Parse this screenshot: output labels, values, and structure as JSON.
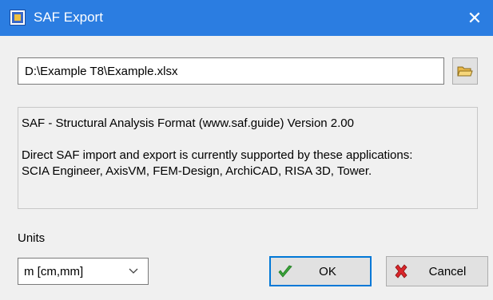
{
  "window": {
    "title": "SAF Export",
    "icon": "saf-app-icon",
    "close_glyph": "✕"
  },
  "file": {
    "path": "D:\\Example T8\\Example.xlsx",
    "browse_icon": "open-folder-icon"
  },
  "info": {
    "line1": "SAF - Structural Analysis Format  (www.saf.guide) Version 2.00",
    "line2": "Direct SAF import and export is currently supported by these applications:",
    "line3": "SCIA Engineer, AxisVM, FEM-Design, ArchiCAD, RISA 3D, Tower."
  },
  "units": {
    "label": "Units",
    "selected": "m [cm,mm]"
  },
  "buttons": {
    "ok_label": "OK",
    "ok_icon": "checkmark-icon",
    "cancel_label": "Cancel",
    "cancel_icon": "red-x-icon"
  },
  "colors": {
    "titlebar": "#2b7de1",
    "accent_border": "#0078d7",
    "ok_check": "#3aa33a",
    "cancel_x": "#d9262b"
  }
}
